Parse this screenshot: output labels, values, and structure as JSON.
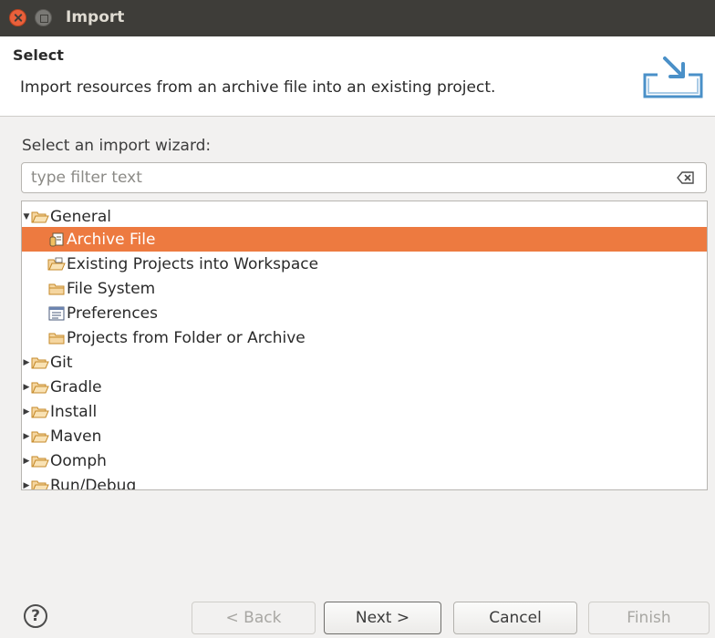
{
  "window": {
    "title": "Import"
  },
  "header": {
    "title": "Select",
    "description": "Import resources from an archive file into an existing project."
  },
  "wizard": {
    "prompt": "Select an import wizard:",
    "filter_placeholder": "type filter text",
    "tree": [
      {
        "label": "General",
        "level": 0,
        "expanded": true,
        "icon": "folder-open-icon"
      },
      {
        "label": "Archive File",
        "level": 1,
        "selected": true,
        "icon": "archive-file-icon"
      },
      {
        "label": "Existing Projects into Workspace",
        "level": 1,
        "icon": "projects-folder-icon"
      },
      {
        "label": "File System",
        "level": 1,
        "icon": "folder-icon"
      },
      {
        "label": "Preferences",
        "level": 1,
        "icon": "preferences-icon"
      },
      {
        "label": "Projects from Folder or Archive",
        "level": 1,
        "icon": "folder-icon"
      },
      {
        "label": "Git",
        "level": 0,
        "expanded": false,
        "icon": "folder-open-icon"
      },
      {
        "label": "Gradle",
        "level": 0,
        "expanded": false,
        "icon": "folder-open-icon"
      },
      {
        "label": "Install",
        "level": 0,
        "expanded": false,
        "icon": "folder-open-icon"
      },
      {
        "label": "Maven",
        "level": 0,
        "expanded": false,
        "icon": "folder-open-icon"
      },
      {
        "label": "Oomph",
        "level": 0,
        "expanded": false,
        "icon": "folder-open-icon"
      },
      {
        "label": "Run/Debug",
        "level": 0,
        "expanded": false,
        "icon": "folder-open-icon"
      }
    ]
  },
  "buttons": {
    "back": "< Back",
    "next": "Next >",
    "cancel": "Cancel",
    "finish": "Finish"
  },
  "colors": {
    "selection": "#ed7a40",
    "titlebar": "#3e3d39"
  }
}
